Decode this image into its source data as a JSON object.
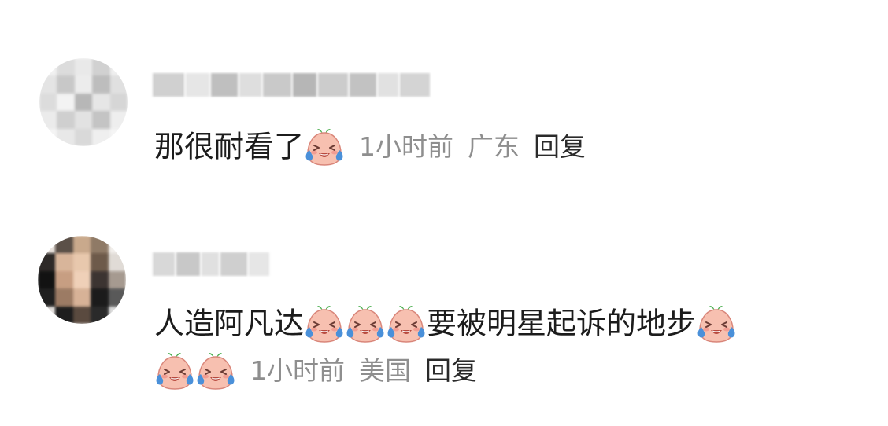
{
  "comments": [
    {
      "username": "",
      "text": "那很耐看了",
      "emoji": "laugh-cry-peach-icon",
      "time": "1小时前",
      "location": "广东",
      "reply_label": "回复"
    },
    {
      "username": "",
      "text_part1": "人造阿凡达",
      "text_part2": "要被明星起诉的地步",
      "emoji": "laugh-cry-peach-icon",
      "time": "1小时前",
      "location": "美国",
      "reply_label": "回复"
    }
  ],
  "colors": {
    "text": "#1c1c1c",
    "meta": "#8e8e8e",
    "reply": "#2a2a2a",
    "emoji_face": "#f6b7a6",
    "emoji_tear": "#4a90d9",
    "emoji_leaf": "#4caf50"
  }
}
